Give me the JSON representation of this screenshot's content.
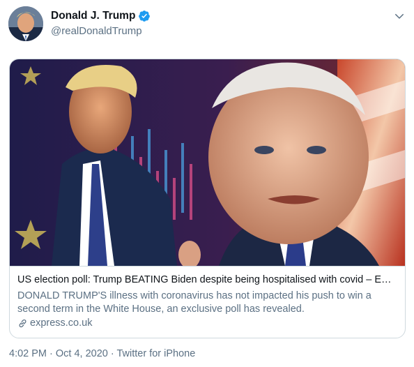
{
  "author": {
    "display_name": "Donald J. Trump",
    "handle": "@realDonaldTrump",
    "verified": true
  },
  "icons": {
    "verified": "verified-badge-icon",
    "more": "chevron-down-icon",
    "link": "link-icon"
  },
  "link_card": {
    "title": "US election poll: Trump BEATING Biden despite being hospitalised with covid – E…",
    "description": "DONALD TRUMP'S illness with coronavirus has not impacted his push to win a second term in the White House, an exclusive poll has revealed.",
    "domain": "express.co.uk"
  },
  "meta": {
    "time": "4:02 PM",
    "separator": " · ",
    "date": "Oct 4, 2020",
    "source": "Twitter for iPhone"
  },
  "colors": {
    "verified_blue": "#1d9bf0",
    "secondary_text": "#5b7083",
    "border": "#cfd9de"
  }
}
